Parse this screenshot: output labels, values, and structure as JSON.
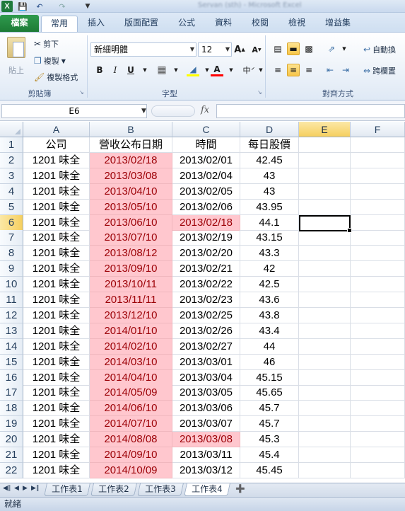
{
  "app": {
    "title": "Servan (sth) - Microsoft Excel",
    "quick_access": [
      "save-icon",
      "undo-icon",
      "redo-icon"
    ]
  },
  "ribbon": {
    "tabs": [
      "檔案",
      "常用",
      "插入",
      "版面配置",
      "公式",
      "資料",
      "校閱",
      "檢視",
      "增益集"
    ],
    "active_tab": "常用",
    "clipboard": {
      "paste": "貼上",
      "cut": "剪下",
      "copy": "複製",
      "format_painter": "複製格式",
      "label": "剪貼簿"
    },
    "font": {
      "name": "新細明體",
      "size": "12",
      "bold": "B",
      "italic": "I",
      "underline": "U",
      "label": "字型",
      "fill_color": "#ffff00",
      "font_color": "#ff0000"
    },
    "alignment": {
      "wrap_text": "自動換",
      "merge": "跨欄置",
      "label": "對齊方式"
    }
  },
  "formula_bar": {
    "name_box": "E6",
    "fx": "fx",
    "formula": ""
  },
  "sheet": {
    "columns": [
      "A",
      "B",
      "C",
      "D",
      "E",
      "F"
    ],
    "selected_column": "E",
    "selected_row": 6,
    "header_row": [
      "公司",
      "營收公布日期",
      "時間",
      "每日股價"
    ],
    "rows": [
      {
        "num": 2,
        "company": "1201 味全",
        "revenue_date": "2013/02/18",
        "time": "2013/02/01",
        "price": "42.45",
        "time_highlight": false
      },
      {
        "num": 3,
        "company": "1201 味全",
        "revenue_date": "2013/03/08",
        "time": "2013/02/04",
        "price": "43",
        "time_highlight": false
      },
      {
        "num": 4,
        "company": "1201 味全",
        "revenue_date": "2013/04/10",
        "time": "2013/02/05",
        "price": "43",
        "time_highlight": false
      },
      {
        "num": 5,
        "company": "1201 味全",
        "revenue_date": "2013/05/10",
        "time": "2013/02/06",
        "price": "43.95",
        "time_highlight": false
      },
      {
        "num": 6,
        "company": "1201 味全",
        "revenue_date": "2013/06/10",
        "time": "2013/02/18",
        "price": "44.1",
        "time_highlight": true
      },
      {
        "num": 7,
        "company": "1201 味全",
        "revenue_date": "2013/07/10",
        "time": "2013/02/19",
        "price": "43.15",
        "time_highlight": false
      },
      {
        "num": 8,
        "company": "1201 味全",
        "revenue_date": "2013/08/12",
        "time": "2013/02/20",
        "price": "43.3",
        "time_highlight": false
      },
      {
        "num": 9,
        "company": "1201 味全",
        "revenue_date": "2013/09/10",
        "time": "2013/02/21",
        "price": "42",
        "time_highlight": false
      },
      {
        "num": 10,
        "company": "1201 味全",
        "revenue_date": "2013/10/11",
        "time": "2013/02/22",
        "price": "42.5",
        "time_highlight": false
      },
      {
        "num": 11,
        "company": "1201 味全",
        "revenue_date": "2013/11/11",
        "time": "2013/02/23",
        "price": "43.6",
        "time_highlight": false
      },
      {
        "num": 12,
        "company": "1201 味全",
        "revenue_date": "2013/12/10",
        "time": "2013/02/25",
        "price": "43.8",
        "time_highlight": false
      },
      {
        "num": 13,
        "company": "1201 味全",
        "revenue_date": "2014/01/10",
        "time": "2013/02/26",
        "price": "43.4",
        "time_highlight": false
      },
      {
        "num": 14,
        "company": "1201 味全",
        "revenue_date": "2014/02/10",
        "time": "2013/02/27",
        "price": "44",
        "time_highlight": false
      },
      {
        "num": 15,
        "company": "1201 味全",
        "revenue_date": "2014/03/10",
        "time": "2013/03/01",
        "price": "46",
        "time_highlight": false
      },
      {
        "num": 16,
        "company": "1201 味全",
        "revenue_date": "2014/04/10",
        "time": "2013/03/04",
        "price": "45.15",
        "time_highlight": false
      },
      {
        "num": 17,
        "company": "1201 味全",
        "revenue_date": "2014/05/09",
        "time": "2013/03/05",
        "price": "45.65",
        "time_highlight": false
      },
      {
        "num": 18,
        "company": "1201 味全",
        "revenue_date": "2014/06/10",
        "time": "2013/03/06",
        "price": "45.7",
        "time_highlight": false
      },
      {
        "num": 19,
        "company": "1201 味全",
        "revenue_date": "2014/07/10",
        "time": "2013/03/07",
        "price": "45.7",
        "time_highlight": false
      },
      {
        "num": 20,
        "company": "1201 味全",
        "revenue_date": "2014/08/08",
        "time": "2013/03/08",
        "price": "45.3",
        "time_highlight": true
      },
      {
        "num": 21,
        "company": "1201 味全",
        "revenue_date": "2014/09/10",
        "time": "2013/03/11",
        "price": "45.4",
        "time_highlight": false
      },
      {
        "num": 22,
        "company": "1201 味全",
        "revenue_date": "2014/10/09",
        "time": "2013/03/12",
        "price": "45.45",
        "time_highlight": false
      }
    ],
    "highlight_fill": "#ffc7ce",
    "highlight_text": "#9c0006"
  },
  "sheet_tabs": [
    "工作表1",
    "工作表2",
    "工作表3",
    "工作表4"
  ],
  "active_sheet": "工作表4",
  "status": {
    "text": "就緒"
  }
}
